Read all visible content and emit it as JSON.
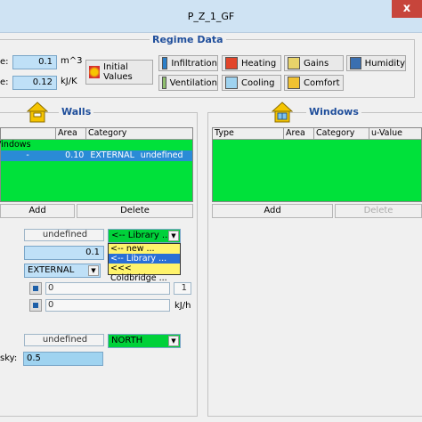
{
  "window": {
    "title": "P_Z_1_GF",
    "close_glyph": "x"
  },
  "regime": {
    "title": "Regime Data",
    "fields": [
      {
        "label": "e:",
        "value": "0.1",
        "unit": "m^3"
      },
      {
        "label": "e:",
        "value": "0.12",
        "unit": "kJ/K"
      }
    ],
    "initial_values_label": "Initial Values",
    "buttons": [
      {
        "label": "Infiltration",
        "icon": "infiltration-icon"
      },
      {
        "label": "Heating",
        "icon": "heating-icon"
      },
      {
        "label": "Gains",
        "icon": "gains-icon"
      },
      {
        "label": "Humidity",
        "icon": "humidity-icon"
      },
      {
        "label": "Ventilation",
        "icon": "ventilation-icon"
      },
      {
        "label": "Cooling",
        "icon": "cooling-icon"
      },
      {
        "label": "Comfort",
        "icon": "comfort-icon"
      }
    ]
  },
  "walls": {
    "title": "Walls",
    "columns": [
      " ",
      "Area",
      "Category"
    ],
    "group_row": "Vindows",
    "row": {
      "name": "-",
      "area": "0.10",
      "category": "EXTERNAL",
      "extra": "undefined"
    },
    "add_label": "Add",
    "delete_label": "Delete"
  },
  "windows": {
    "title": "Windows",
    "columns": [
      "Type",
      "Area",
      "Category",
      "u-Value"
    ],
    "add_label": "Add",
    "delete_label": "Delete"
  },
  "details": {
    "construction_value": "undefined",
    "library_combo": "<-- Library ...",
    "library_options": [
      "<-- new ...",
      "<-- Library ...",
      "<<< Coldbridge ..."
    ],
    "area_value": "0.1",
    "category_combo": "EXTERNAL",
    "field_a": "0",
    "field_a_right": "1",
    "field_b": "0",
    "field_b_unit": "kJ/h",
    "orientation_value": "undefined",
    "orientation_combo": "NORTH",
    "sky_label": "sky:",
    "sky_value": "0.5"
  },
  "colors": {
    "list_bg": "#00e13a",
    "selection": "#2a8bd6",
    "field_bg": "#bfe0f7",
    "header_text": "#1f4e9b"
  }
}
